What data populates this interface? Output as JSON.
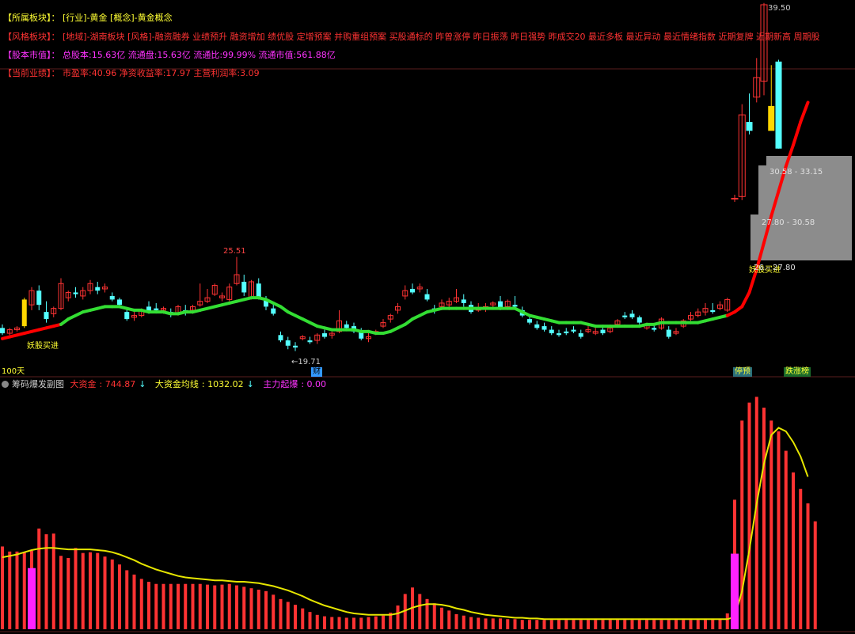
{
  "info_rows": [
    {
      "key": "【所属板块】：",
      "value": "[行业]-黄金 [概念]-黄金概念",
      "key_color": "#ffff33",
      "value_color": "#ffff33"
    },
    {
      "key": "【风格板块】：",
      "value": "[地域]-湖南板块 [风格]-融资融券 业绩预升 融资增加 绩优股 定增预案 并购重组预案 买股通标的 昨曾涨停 昨日振荡 昨日强势 昨成交20 最近多板 最近异动 最近情绪指数 近期复牌 近期新高 周期股",
      "key_color": "#ff3333",
      "value_color": "#ff3333"
    },
    {
      "key": "【股本市值】：",
      "value": "总股本:15.63亿 流通盘:15.63亿 流通比:99.99% 流通市值:561.88亿",
      "key_color": "#ff33ff",
      "value_color": "#ff33ff"
    },
    {
      "key": "【当前业绩】：",
      "value": "市盈率:40.96 净资收益率:17.97 主营利润率:3.09",
      "key_color": "#ff3333",
      "value_color": "#ff3333"
    }
  ],
  "main_chart": {
    "labels": {
      "high_price": "25.51",
      "low_price": "←19.71",
      "top_price": "39.50",
      "period": "100天",
      "buy_signal_1": "妖股买进",
      "buy_signal_2": "妖股买进",
      "finance_marker": "财",
      "tag_limit_up": "停预",
      "tag_rise_stop": "跌涨榜"
    },
    "zones": [
      {
        "label": "30.58 - 33.15"
      },
      {
        "label": "27.80 - 30.58"
      },
      {
        "label": "26.– 27.80"
      }
    ]
  },
  "sub_chart": {
    "title": "筹码爆发副图",
    "fields": [
      {
        "label": "大资金",
        "value": "744.87",
        "arrow": "↓",
        "color": "#ff3333"
      },
      {
        "label": "大资金均线",
        "value": "1032.02",
        "arrow": "↓",
        "color": "#ffff33"
      },
      {
        "label": "主力起爆",
        "value": "0.00",
        "arrow": "",
        "color": "#ff33ff"
      }
    ]
  },
  "colors": {
    "up": "#ff3333",
    "down": "#54ffff",
    "ma_up": "#ff0000",
    "ma_down": "#33dd33",
    "yellow": "#ffd700",
    "avg_line": "#e6e600",
    "pulse": "#ff22ff",
    "zone": "#8c8c8c"
  },
  "chart_data": [
    {
      "type": "candlestick",
      "title": "",
      "annotations": [
        "25.51",
        "←19.71",
        "39.50",
        "妖股买进"
      ],
      "candles": [
        [
          21.3,
          21.5,
          20.9,
          21.0
        ],
        [
          21.0,
          21.3,
          20.9,
          21.2
        ],
        [
          21.2,
          21.4,
          21.1,
          21.3
        ],
        [
          21.4,
          23.0,
          21.3,
          22.9
        ],
        [
          22.6,
          23.6,
          22.3,
          23.4
        ],
        [
          23.4,
          23.7,
          22.3,
          22.6
        ],
        [
          22.2,
          22.8,
          21.6,
          21.8
        ],
        [
          22.1,
          22.5,
          21.9,
          22.4
        ],
        [
          22.4,
          24.1,
          22.3,
          23.8
        ],
        [
          23.0,
          23.4,
          22.8,
          23.3
        ],
        [
          23.3,
          23.6,
          23.0,
          23.2
        ],
        [
          23.1,
          23.6,
          22.9,
          23.4
        ],
        [
          23.4,
          24.0,
          23.2,
          23.8
        ],
        [
          23.6,
          23.9,
          23.2,
          23.4
        ],
        [
          23.5,
          23.8,
          23.3,
          23.6
        ],
        [
          23.1,
          23.3,
          22.8,
          22.9
        ],
        [
          22.9,
          23.0,
          22.5,
          22.6
        ],
        [
          22.2,
          22.4,
          21.7,
          21.8
        ],
        [
          21.9,
          22.2,
          21.7,
          22.0
        ],
        [
          22.0,
          22.4,
          21.9,
          22.3
        ],
        [
          22.5,
          22.8,
          22.1,
          22.2
        ],
        [
          22.4,
          22.7,
          22.2,
          22.3
        ],
        [
          22.3,
          22.5,
          22.1,
          22.4
        ],
        [
          22.2,
          22.4,
          21.9,
          22.1
        ],
        [
          22.1,
          22.6,
          22.0,
          22.5
        ],
        [
          22.3,
          22.6,
          22.0,
          22.2
        ],
        [
          22.3,
          22.6,
          22.1,
          22.5
        ],
        [
          22.6,
          23.8,
          22.5,
          22.8
        ],
        [
          22.8,
          23.5,
          22.7,
          23.0
        ],
        [
          23.2,
          23.8,
          23.1,
          23.7
        ],
        [
          23.0,
          23.3,
          22.8,
          23.1
        ],
        [
          22.9,
          23.8,
          22.8,
          23.6
        ],
        [
          23.8,
          25.3,
          23.7,
          24.3
        ],
        [
          23.9,
          24.3,
          23.1,
          23.3
        ],
        [
          23.0,
          24.0,
          22.9,
          23.9
        ],
        [
          23.8,
          24.1,
          22.9,
          23.0
        ],
        [
          22.9,
          23.1,
          22.3,
          22.5
        ],
        [
          22.4,
          22.7,
          22.0,
          22.1
        ],
        [
          20.9,
          21.1,
          20.5,
          20.6
        ],
        [
          20.6,
          20.8,
          20.1,
          20.3
        ],
        [
          20.3,
          20.5,
          20.0,
          20.2
        ],
        [
          20.7,
          20.9,
          20.6,
          20.8
        ],
        [
          20.6,
          20.8,
          20.4,
          20.5
        ],
        [
          20.6,
          21.0,
          20.4,
          20.9
        ],
        [
          21.0,
          21.2,
          20.7,
          20.8
        ],
        [
          20.9,
          21.1,
          20.7,
          21.0
        ],
        [
          21.1,
          22.3,
          21.0,
          21.7
        ],
        [
          21.5,
          21.7,
          21.2,
          21.3
        ],
        [
          21.4,
          21.6,
          21.0,
          21.1
        ],
        [
          21.1,
          21.3,
          20.6,
          20.7
        ],
        [
          20.7,
          21.0,
          20.5,
          20.8
        ],
        [
          21.0,
          21.2,
          20.9,
          21.1
        ],
        [
          21.4,
          21.8,
          21.3,
          21.6
        ],
        [
          21.8,
          22.1,
          21.6,
          22.0
        ],
        [
          22.3,
          22.7,
          22.1,
          22.5
        ],
        [
          23.1,
          23.7,
          22.9,
          23.4
        ],
        [
          23.5,
          23.8,
          23.2,
          23.3
        ],
        [
          23.5,
          23.8,
          23.3,
          23.6
        ],
        [
          23.2,
          23.5,
          22.8,
          22.9
        ],
        [
          22.4,
          22.6,
          22.1,
          22.3
        ],
        [
          22.5,
          22.9,
          22.3,
          22.7
        ],
        [
          22.6,
          23.0,
          22.3,
          22.8
        ],
        [
          22.8,
          23.5,
          22.7,
          23.0
        ],
        [
          22.9,
          23.2,
          22.5,
          22.7
        ],
        [
          22.6,
          22.8,
          22.1,
          22.2
        ],
        [
          22.3,
          22.7,
          22.2,
          22.4
        ],
        [
          22.4,
          22.7,
          22.2,
          22.5
        ],
        [
          22.6,
          22.8,
          22.4,
          22.7
        ],
        [
          22.8,
          23.1,
          22.3,
          22.4
        ],
        [
          22.5,
          22.9,
          22.4,
          22.8
        ],
        [
          22.6,
          23.1,
          22.4,
          22.5
        ],
        [
          22.3,
          22.5,
          21.9,
          22.0
        ],
        [
          21.8,
          22.0,
          21.5,
          21.6
        ],
        [
          21.5,
          21.7,
          21.2,
          21.3
        ],
        [
          21.4,
          21.6,
          21.1,
          21.2
        ],
        [
          21.2,
          21.4,
          20.9,
          21.0
        ],
        [
          21.0,
          21.2,
          20.8,
          20.9
        ],
        [
          21.1,
          21.3,
          20.9,
          21.0
        ],
        [
          21.2,
          21.4,
          21.0,
          21.1
        ],
        [
          21.0,
          21.2,
          20.7,
          20.8
        ],
        [
          21.1,
          21.4,
          21.0,
          21.2
        ],
        [
          21.0,
          21.3,
          20.9,
          21.1
        ],
        [
          21.2,
          21.4,
          20.9,
          21.0
        ],
        [
          21.1,
          21.4,
          21.0,
          21.3
        ],
        [
          21.5,
          21.8,
          21.4,
          21.7
        ],
        [
          22.0,
          22.2,
          21.8,
          21.9
        ],
        [
          22.1,
          22.3,
          21.8,
          21.9
        ],
        [
          21.9,
          22.0,
          21.5,
          21.6
        ],
        [
          21.3,
          21.6,
          21.2,
          21.5
        ],
        [
          21.3,
          21.5,
          21.1,
          21.2
        ],
        [
          21.3,
          21.9,
          21.2,
          21.8
        ],
        [
          21.2,
          21.4,
          20.7,
          20.8
        ],
        [
          21.0,
          21.3,
          20.9,
          21.1
        ],
        [
          21.4,
          21.8,
          21.3,
          21.7
        ],
        [
          21.8,
          22.2,
          21.7,
          22.0
        ],
        [
          22.0,
          22.4,
          21.9,
          22.2
        ],
        [
          22.2,
          22.7,
          22.0,
          22.4
        ],
        [
          22.3,
          22.7,
          22.1,
          22.2
        ],
        [
          22.4,
          22.8,
          22.3,
          22.6
        ],
        [
          22.3,
          23.0,
          22.2,
          22.9
        ],
        [
          28.6,
          28.8,
          28.4,
          28.6
        ],
        [
          28.7,
          33.9,
          28.5,
          33.3
        ],
        [
          32.9,
          34.5,
          32.2,
          32.4
        ],
        [
          34.3,
          36.5,
          34.0,
          35.4
        ],
        [
          35.2,
          39.6,
          34.4,
          39.5
        ],
        [
          33.8,
          36.1,
          33.4,
          32.4
        ],
        [
          36.3,
          36.4,
          31.4,
          31.4
        ]
      ],
      "ma": [
        20.7,
        20.8,
        20.9,
        21.0,
        21.1,
        21.2,
        21.3,
        21.4,
        21.5,
        21.8,
        22.0,
        22.2,
        22.3,
        22.4,
        22.5,
        22.5,
        22.5,
        22.4,
        22.3,
        22.3,
        22.2,
        22.2,
        22.2,
        22.1,
        22.1,
        22.2,
        22.2,
        22.3,
        22.4,
        22.5,
        22.6,
        22.7,
        22.8,
        22.9,
        23.0,
        23.0,
        22.9,
        22.7,
        22.5,
        22.2,
        22.0,
        21.8,
        21.6,
        21.4,
        21.3,
        21.2,
        21.2,
        21.2,
        21.2,
        21.1,
        21.1,
        21.0,
        21.0,
        21.1,
        21.3,
        21.5,
        21.8,
        22.0,
        22.2,
        22.3,
        22.4,
        22.4,
        22.4,
        22.4,
        22.4,
        22.4,
        22.4,
        22.4,
        22.4,
        22.4,
        22.4,
        22.2,
        22.0,
        21.9,
        21.8,
        21.7,
        21.6,
        21.6,
        21.6,
        21.6,
        21.5,
        21.4,
        21.4,
        21.4,
        21.4,
        21.4,
        21.4,
        21.4,
        21.5,
        21.5,
        21.6,
        21.6,
        21.6,
        21.6,
        21.6,
        21.6,
        21.7,
        21.8,
        21.9,
        22.0,
        22.2,
        22.5,
        23.3,
        24.6,
        26.1,
        27.6,
        29.0,
        30.4,
        31.6,
        32.9,
        34.0
      ],
      "ma_color_switch": [
        1,
        2,
        3,
        104,
        105,
        106,
        107,
        108,
        109,
        110,
        111
      ]
    },
    {
      "type": "bar",
      "title": "筹码爆发副图",
      "series": [
        {
          "name": "大资金",
          "values": [
            115,
            108,
            108,
            107,
            109,
            140,
            132,
            133,
            102,
            99,
            113,
            106,
            107,
            106,
            101,
            97,
            90,
            82,
            76,
            70,
            66,
            63,
            63,
            63,
            63,
            63,
            63,
            63,
            62,
            61,
            62,
            63,
            61,
            59,
            57,
            55,
            53,
            48,
            42,
            38,
            34,
            29,
            24,
            20,
            18,
            17,
            17,
            16,
            16,
            16,
            17,
            18,
            19,
            23,
            33,
            49,
            58,
            49,
            42,
            36,
            30,
            26,
            21,
            19,
            17,
            16,
            15,
            15,
            15,
            14,
            14,
            13,
            13,
            13,
            13,
            13,
            13,
            13,
            13,
            13,
            13,
            13,
            13,
            13,
            13,
            13,
            13,
            13,
            13,
            13,
            13,
            13,
            13,
            13,
            13,
            13,
            13,
            14,
            14,
            22,
            180,
            290,
            315,
            323,
            308,
            290,
            275,
            248,
            218,
            195,
            175,
            150
          ]
        },
        {
          "name": "大资金均线",
          "values": [
            100,
            102,
            104,
            107,
            110,
            112,
            113,
            113,
            112,
            111,
            111,
            111,
            111,
            110,
            109,
            107,
            104,
            100,
            96,
            91,
            87,
            83,
            80,
            77,
            74,
            72,
            71,
            70,
            69,
            68,
            68,
            67,
            66,
            66,
            65,
            64,
            62,
            60,
            57,
            54,
            50,
            46,
            41,
            37,
            33,
            30,
            27,
            24,
            22,
            21,
            20,
            20,
            20,
            20,
            22,
            26,
            30,
            33,
            35,
            35,
            34,
            32,
            29,
            27,
            24,
            22,
            20,
            19,
            18,
            17,
            16,
            16,
            15,
            15,
            14,
            14,
            14,
            14,
            14,
            14,
            14,
            14,
            14,
            14,
            14,
            14,
            14,
            14,
            14,
            14,
            14,
            14,
            14,
            14,
            14,
            14,
            14,
            14,
            14,
            14,
            17,
            53,
            110,
            175,
            230,
            270,
            280,
            275,
            260,
            240,
            212
          ]
        },
        {
          "name": "主力起爆",
          "values": [
            0,
            0,
            0,
            0,
            85,
            0,
            0,
            0,
            0,
            0,
            0,
            0,
            0,
            0,
            0,
            0,
            0,
            0,
            0,
            0,
            0,
            0,
            0,
            0,
            0,
            0,
            0,
            0,
            0,
            0,
            0,
            0,
            0,
            0,
            0,
            0,
            0,
            0,
            0,
            0,
            0,
            0,
            0,
            0,
            0,
            0,
            0,
            0,
            0,
            0,
            0,
            0,
            0,
            0,
            0,
            0,
            0,
            0,
            0,
            0,
            0,
            0,
            0,
            0,
            0,
            0,
            0,
            0,
            0,
            0,
            0,
            0,
            0,
            0,
            0,
            0,
            0,
            0,
            0,
            0,
            0,
            0,
            0,
            0,
            0,
            0,
            0,
            0,
            0,
            0,
            0,
            0,
            0,
            0,
            0,
            0,
            0,
            0,
            0,
            0,
            105,
            0,
            0,
            0,
            0,
            0,
            0,
            0,
            0,
            0,
            0,
            0
          ]
        }
      ]
    }
  ]
}
